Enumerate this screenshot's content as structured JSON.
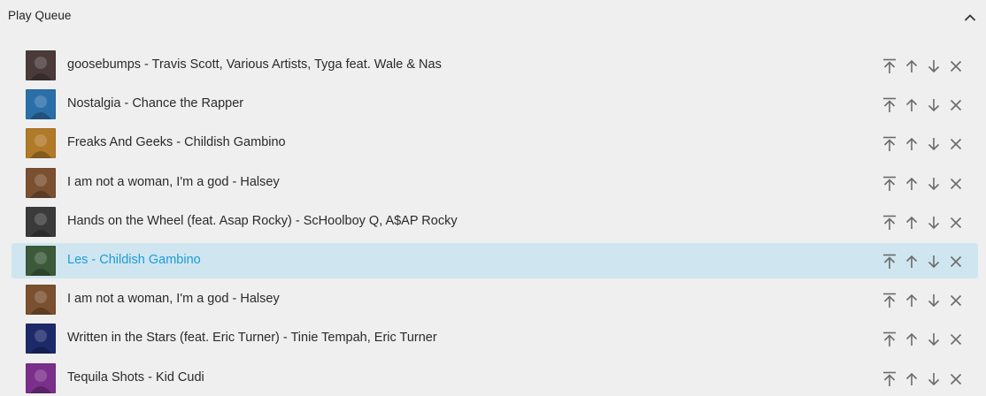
{
  "header": {
    "title": "Play Queue",
    "collapse_icon": "chevron-up-icon"
  },
  "queue": {
    "active_index": 5,
    "items": [
      {
        "label": "goosebumps - Travis Scott, Various Artists, Tyga feat. Wale & Nas",
        "art_color": "#4a3a3a"
      },
      {
        "label": "Nostalgia - Chance the Rapper",
        "art_color": "#2a6fa8"
      },
      {
        "label": "Freaks And Geeks - Childish Gambino",
        "art_color": "#b07a28"
      },
      {
        "label": "I am not a woman, I'm a god - Halsey",
        "art_color": "#7a5030"
      },
      {
        "label": "Hands on the Wheel (feat. Asap Rocky) - ScHoolboy Q, A$AP Rocky",
        "art_color": "#3a3a3a"
      },
      {
        "label": "Les - Childish Gambino",
        "art_color": "#3c5a3a"
      },
      {
        "label": "I am not a woman, I'm a god - Halsey",
        "art_color": "#7a5030"
      },
      {
        "label": "Written in the Stars (feat. Eric Turner) - Tinie Tempah, Eric Turner",
        "art_color": "#1c2a6a"
      },
      {
        "label": "Tequila Shots - Kid Cudi",
        "art_color": "#7a2f8a"
      }
    ],
    "row_actions": [
      "move-to-top-icon",
      "move-up-icon",
      "move-down-icon",
      "remove-icon"
    ]
  },
  "colors": {
    "background": "#efefef",
    "active_row": "#cfe6f0",
    "active_text": "#1e9bd7",
    "icon": "#6b6b6b"
  }
}
